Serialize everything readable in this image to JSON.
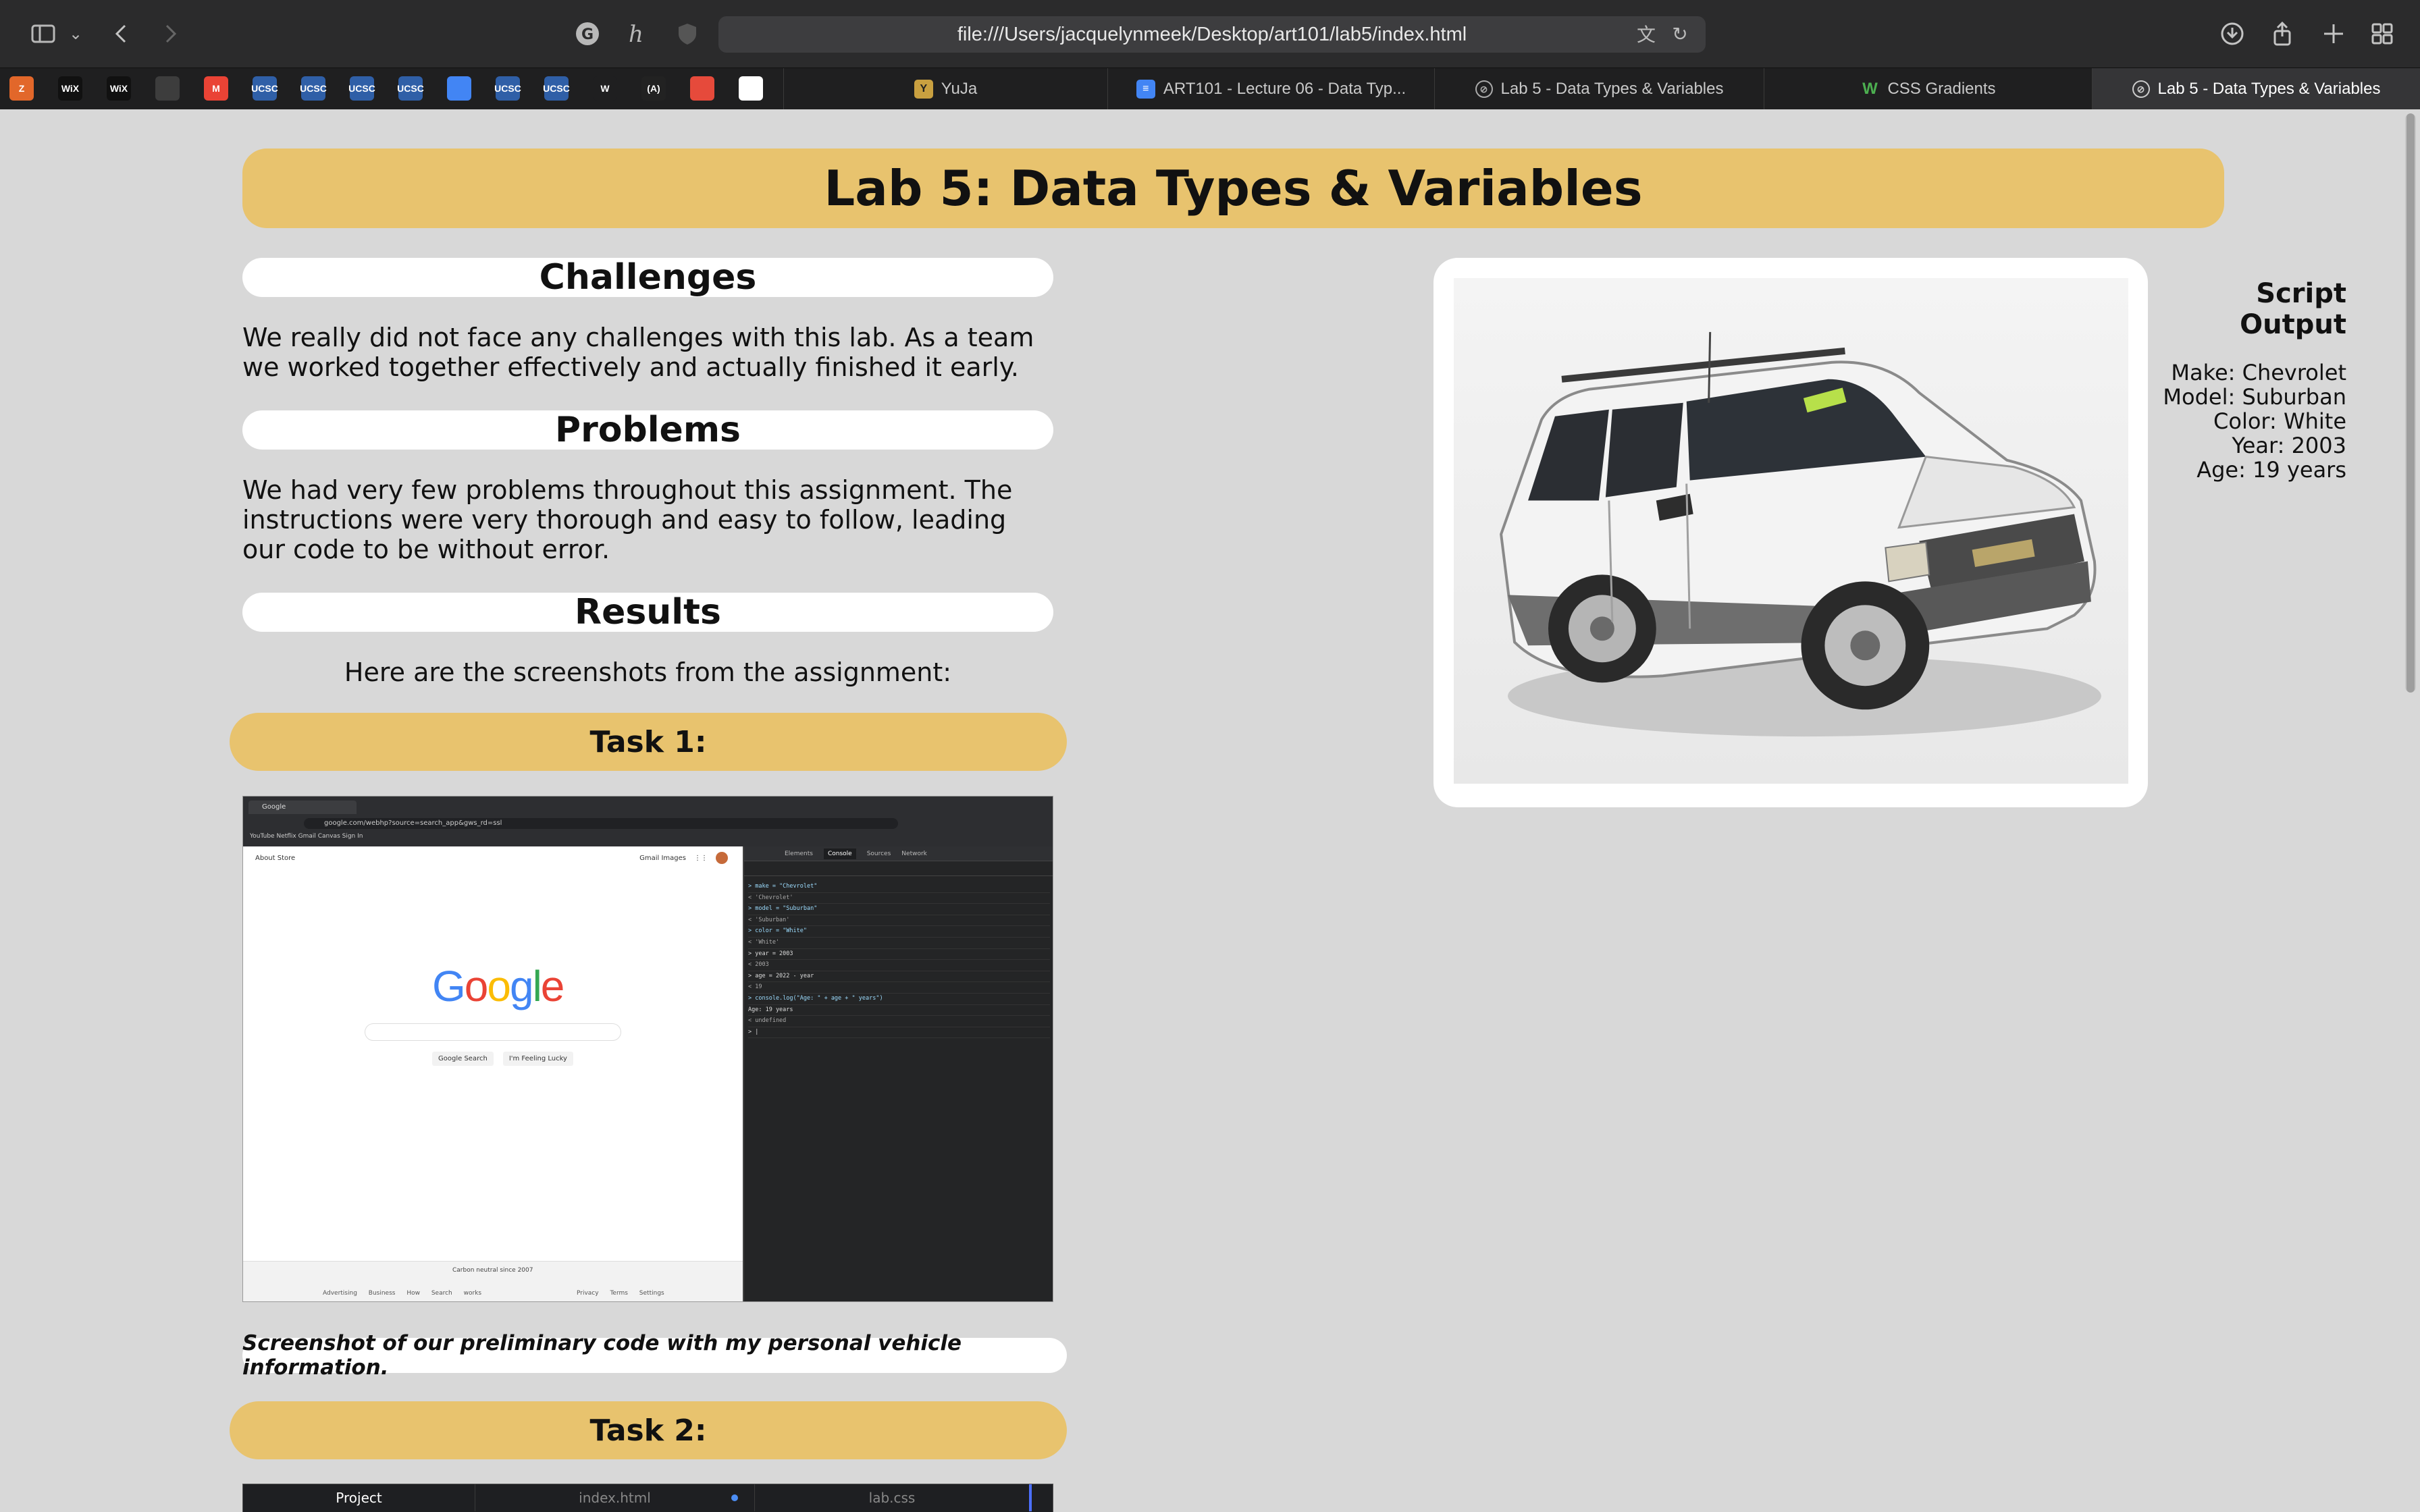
{
  "browser": {
    "url": "file:///Users/jacquelynmeek/Desktop/art101/lab5/index.html",
    "bookmarks": [
      {
        "icon": "z-icon",
        "label": "Z",
        "color": "#e2672a"
      },
      {
        "icon": "wix-icon",
        "label": "WiX",
        "color": "#111111"
      },
      {
        "icon": "wix-icon",
        "label": "WiX",
        "color": "#111111"
      },
      {
        "icon": "monitor-icon",
        "label": "",
        "color": "#3d3d3d"
      },
      {
        "icon": "gmail-icon",
        "label": "M",
        "color": "#ea4335"
      },
      {
        "icon": "ucsc-icon",
        "label": "UCSC",
        "color": "#2f5fa7"
      },
      {
        "icon": "ucsc-icon",
        "label": "UCSC",
        "color": "#2f5fa7"
      },
      {
        "icon": "ucsc-icon",
        "label": "UCSC",
        "color": "#2f5fa7"
      },
      {
        "icon": "ucsc-icon",
        "label": "UCSC",
        "color": "#2f5fa7"
      },
      {
        "icon": "docs-icon",
        "label": "",
        "color": "#4285f4"
      },
      {
        "icon": "ucsc-icon",
        "label": "UCSC",
        "color": "#2f5fa7"
      },
      {
        "icon": "ucsc-icon",
        "label": "UCSC",
        "color": "#2f5fa7"
      },
      {
        "icon": "w-icon",
        "label": "W",
        "color": "#1f1f20"
      },
      {
        "icon": "codepen-icon",
        "label": "(A)",
        "color": "#222222"
      },
      {
        "icon": "swirl-icon",
        "label": "",
        "color": "#e64a3b"
      },
      {
        "icon": "github-icon",
        "label": "",
        "color": "#ffffff"
      }
    ],
    "tabs": [
      {
        "title": "YuJa",
        "icon": "yuja-icon",
        "active": false
      },
      {
        "title": "ART101 - Lecture 06 - Data Typ...",
        "icon": "docs-icon",
        "active": false
      },
      {
        "title": "Lab 5 - Data Types & Variables",
        "icon": "compass-icon",
        "active": false
      },
      {
        "title": "CSS Gradients",
        "icon": "w-icon",
        "active": false
      },
      {
        "title": "Lab 5 - Data Types & Variables",
        "icon": "compass-icon",
        "active": true
      }
    ]
  },
  "page": {
    "title": "Lab 5: Data Types & Variables",
    "challenges_heading": "Challenges",
    "challenges_text": "We really did not face any challenges with this lab. As a team we worked together effectively and actually finished it early.",
    "problems_heading": "Problems",
    "problems_text": "We had very few problems throughout this assignment. The instructions were very thorough and easy to follow, leading our code to be without error.",
    "results_heading": "Results",
    "results_text": "Here are the screenshots from the assignment:",
    "task1": "Task 1:",
    "task1_caption": "Screenshot of our preliminary code with my personal vehicle information.",
    "task2": "Task 2:",
    "task2_tabs": [
      "Project",
      "index.html",
      "lab.css"
    ]
  },
  "screenshot1": {
    "tab_title": "Google",
    "url": "google.com/webhp?source=search_app&gws_rd=ssl",
    "bookmarks_bar": "YouTube   Netflix   Gmail   Canvas Sign In",
    "google_top_left": "About   Store",
    "google_top_right": "Gmail   Images",
    "logo": "Google",
    "btn_search": "Google Search",
    "btn_lucky": "I'm Feeling Lucky",
    "carbon": "Carbon neutral since 2007",
    "footer_left": "Advertising Business How Search works",
    "footer_right": "Privacy Terms Settings",
    "devtools_tabs": [
      "Elements",
      "Console",
      "Sources",
      "Network"
    ],
    "console_lines": [
      "> make = \"Chevrolet\"",
      "< 'Chevrolet'",
      "> model = \"Suburban\"",
      "< 'Suburban'",
      "> color = \"White\"",
      "< 'White'",
      "> year = 2003",
      "< 2003",
      "> age = 2022 - year",
      "< 19",
      "> console.log(\"Age: \" + age + \" years\")",
      "  Age: 19 years",
      "< undefined",
      "> |"
    ]
  },
  "script_output": {
    "heading": "Script Output",
    "make": "Make: Chevrolet",
    "model": "Model: Suburban",
    "color": "Color: White",
    "year": "Year: 2003",
    "age": "Age: 19 years"
  },
  "colors": {
    "banner": "#e8c36e",
    "page_bg": "#d8d8d8",
    "toolbar_bg": "#2b2b2c"
  }
}
